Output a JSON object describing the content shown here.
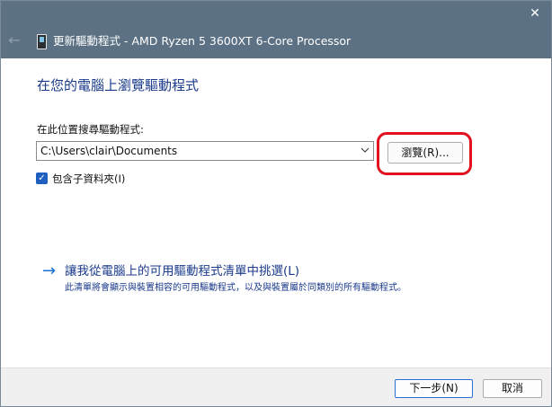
{
  "window": {
    "title": "更新驅動程式 - AMD Ryzen 5 3600XT 6-Core Processor",
    "close_glyph": "✕",
    "back_glyph": "←"
  },
  "main": {
    "heading": "在您的電腦上瀏覽驅動程式",
    "search_label": "在此位置搜尋驅動程式:",
    "path_value": "C:\\Users\\clair\\Documents",
    "browse_label": "瀏覽(R)...",
    "include_subfolders": {
      "label": "包含子資料夾(I)",
      "checked": true,
      "check_glyph": "✓"
    },
    "pick": {
      "arrow": "→",
      "link": "讓我從電腦上的可用驅動程式清單中挑選(L)",
      "description": "此清單將會顯示與裝置相容的可用驅動程式，以及與裝置屬於同類別的所有驅動程式。"
    }
  },
  "footer": {
    "next_label": "下一步(N)",
    "cancel_label": "取消"
  },
  "colors": {
    "titlebar": "#5c7184",
    "link": "#1a3a8a",
    "highlight": "#e3101d",
    "accent": "#1f5fbf"
  },
  "icons": {
    "device": "device-chip-icon",
    "combo": "chevron-down-icon"
  }
}
